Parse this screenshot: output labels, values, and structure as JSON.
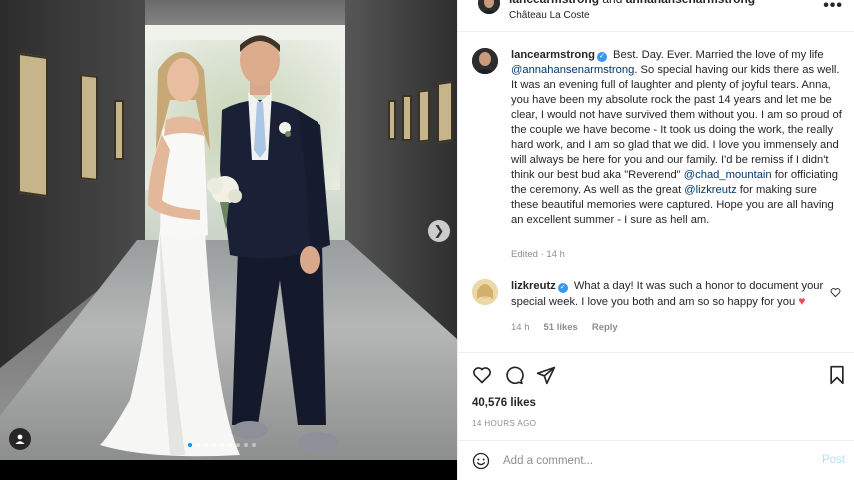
{
  "header": {
    "author": "lancearmstrong",
    "and_text": "and",
    "coauthor": "annahansenarmstrong",
    "location": "Château La Coste",
    "more_icon": "more-horizontal-icon"
  },
  "caption": {
    "username": "lancearmstrong",
    "verified": true,
    "segments": [
      {
        "type": "text",
        "value": "Best. Day. Ever. Married the love of my life "
      },
      {
        "type": "mention",
        "value": "@annahansenarmstrong"
      },
      {
        "type": "text",
        "value": ". So special having our kids there as well. It was an evening full of laughter and plenty of joyful tears. Anna, you have been my absolute rock the past 14 years and let me be clear, I would not have survived them without you. I am so proud of the couple we have become - It took us doing the work, the really hard work, and I am so glad that we did. I love you immensely and will always be here for you and our family. I'd be remiss if I didn't think our best bud aka \"Reverend\" "
      },
      {
        "type": "mention",
        "value": "@chad_mountain"
      },
      {
        "type": "text",
        "value": " for officiating the ceremony. As well as the great "
      },
      {
        "type": "mention",
        "value": "@lizkreutz"
      },
      {
        "type": "text",
        "value": " for making sure these beautiful memories were captured. Hope you are all having an excellent summer - I sure as hell am."
      }
    ],
    "edited": "Edited · 14 h"
  },
  "comment": {
    "username": "lizkreutz",
    "verified": true,
    "text": "What a day! It was such a honor to document your special week. I love you both and am so so happy for you",
    "emoji": "♥",
    "time": "14 h",
    "likes": "51 likes",
    "reply": "Reply",
    "like_icon": "heart-outline-icon"
  },
  "actions": {
    "icons": [
      "heart-outline-icon",
      "comment-icon",
      "share-icon",
      "bookmark-icon"
    ],
    "likes": "40,576 likes",
    "time_ago": "14 HOURS AGO"
  },
  "add_comment": {
    "placeholder": "Add a comment...",
    "post_label": "Post",
    "emoji_icon": "emoji-icon"
  },
  "carousel": {
    "slides": 9,
    "active_index": 0,
    "next_icon": "chevron-right-icon",
    "tag_icon": "user-tag-icon"
  },
  "colors": {
    "verified": "#3897f0",
    "mention": "#00376b",
    "muted": "#8e8e8e",
    "post_disabled": "#b2dffc",
    "active_dot": "#0095f6",
    "heart": "#ed4956"
  }
}
